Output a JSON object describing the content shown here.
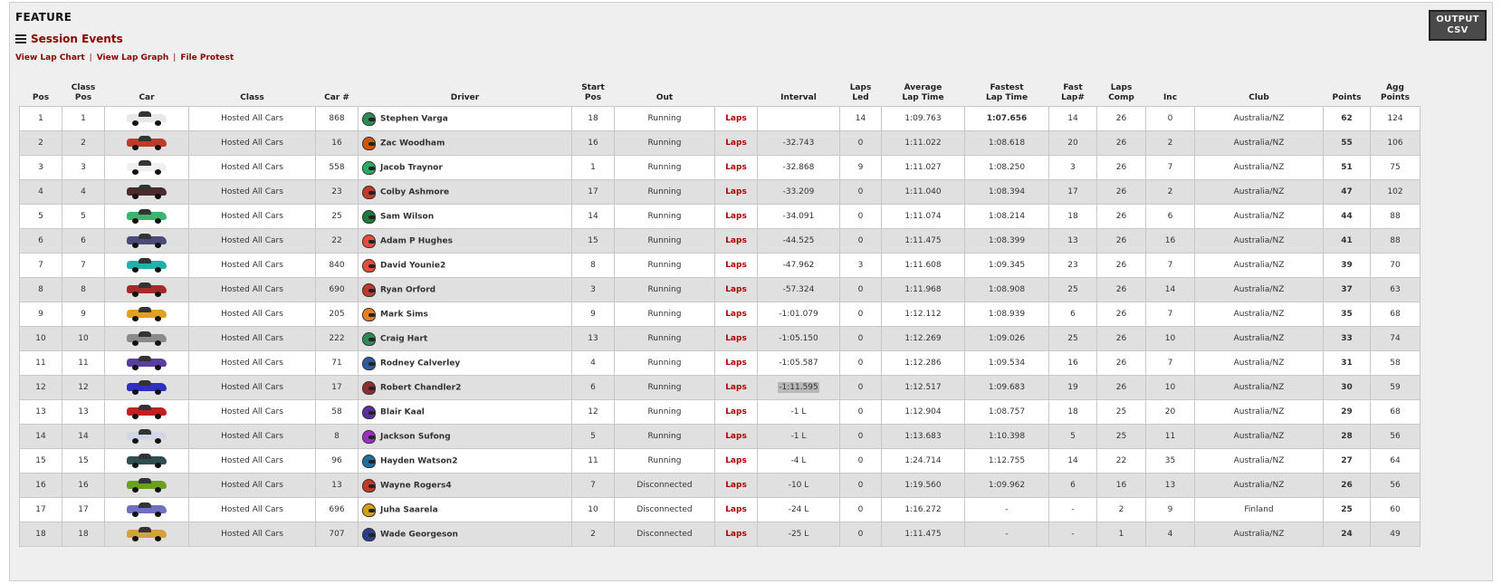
{
  "header": {
    "feature_title": "FEATURE",
    "session_events": "Session Events",
    "output_csv_line1": "OUTPUT",
    "output_csv_line2": "CSV"
  },
  "links": [
    "View Lap Chart",
    "View Lap Graph",
    "File Protest"
  ],
  "columns": [
    "Pos",
    "Class Pos",
    "Car",
    "Class",
    "Car #",
    "Driver",
    "Start\nPos",
    "Out",
    "",
    "Interval",
    "Laps\nLed",
    "Average\nLap Time",
    "Fastest\nLap Time",
    "Fast\nLap#",
    "Laps\nComp",
    "Inc",
    "Club",
    "Points",
    "Agg\nPoints"
  ],
  "laps_label": "Laps",
  "rows": [
    {
      "pos": "1",
      "class_pos": "1",
      "car_color": "#e8e8e8",
      "class": "Hosted All Cars",
      "car_num": "868",
      "helmet": "#2e8b57",
      "driver": "Stephen Varga",
      "start_pos": "18",
      "out": "Running",
      "interval": "",
      "laps_led": "14",
      "avg": "1:09.763",
      "fastest": "1:07.656",
      "fast_lap": "14",
      "laps_comp": "26",
      "inc": "0",
      "club": "Australia/NZ",
      "points": "62",
      "agg": "124"
    },
    {
      "pos": "2",
      "class_pos": "2",
      "car_color": "#c0392b",
      "class": "Hosted All Cars",
      "car_num": "16",
      "helmet": "#d35400",
      "driver": "Zac Woodham",
      "start_pos": "16",
      "out": "Running",
      "interval": "-32.743",
      "laps_led": "0",
      "avg": "1:11.022",
      "fastest": "1:08.618",
      "fast_lap": "20",
      "laps_comp": "26",
      "inc": "2",
      "club": "Australia/NZ",
      "points": "55",
      "agg": "106"
    },
    {
      "pos": "3",
      "class_pos": "3",
      "car_color": "#f0f0f0",
      "class": "Hosted All Cars",
      "car_num": "558",
      "helmet": "#27ae60",
      "driver": "Jacob Traynor",
      "start_pos": "1",
      "out": "Running",
      "interval": "-32.868",
      "laps_led": "9",
      "avg": "1:11.027",
      "fastest": "1:08.250",
      "fast_lap": "3",
      "laps_comp": "26",
      "inc": "7",
      "club": "Australia/NZ",
      "points": "51",
      "agg": "75"
    },
    {
      "pos": "4",
      "class_pos": "4",
      "car_color": "#4a2a2a",
      "class": "Hosted All Cars",
      "car_num": "23",
      "helmet": "#c0392b",
      "driver": "Colby Ashmore",
      "start_pos": "17",
      "out": "Running",
      "interval": "-33.209",
      "laps_led": "0",
      "avg": "1:11.040",
      "fastest": "1:08.394",
      "fast_lap": "17",
      "laps_comp": "26",
      "inc": "2",
      "club": "Australia/NZ",
      "points": "47",
      "agg": "102"
    },
    {
      "pos": "5",
      "class_pos": "5",
      "car_color": "#3cb371",
      "class": "Hosted All Cars",
      "car_num": "25",
      "helmet": "#1e7a3a",
      "driver": "Sam Wilson",
      "start_pos": "14",
      "out": "Running",
      "interval": "-34.091",
      "laps_led": "0",
      "avg": "1:11.074",
      "fastest": "1:08.214",
      "fast_lap": "18",
      "laps_comp": "26",
      "inc": "6",
      "club": "Australia/NZ",
      "points": "44",
      "agg": "88"
    },
    {
      "pos": "6",
      "class_pos": "6",
      "car_color": "#4b4b7a",
      "class": "Hosted All Cars",
      "car_num": "22",
      "helmet": "#e74c3c",
      "driver": "Adam P Hughes",
      "start_pos": "15",
      "out": "Running",
      "interval": "-44.525",
      "laps_led": "0",
      "avg": "1:11.475",
      "fastest": "1:08.399",
      "fast_lap": "13",
      "laps_comp": "26",
      "inc": "16",
      "club": "Australia/NZ",
      "points": "41",
      "agg": "88"
    },
    {
      "pos": "7",
      "class_pos": "7",
      "car_color": "#20b2aa",
      "class": "Hosted All Cars",
      "car_num": "840",
      "helmet": "#e74c3c",
      "driver": "David Younie2",
      "start_pos": "8",
      "out": "Running",
      "interval": "-47.962",
      "laps_led": "3",
      "avg": "1:11.608",
      "fastest": "1:09.345",
      "fast_lap": "23",
      "laps_comp": "26",
      "inc": "7",
      "club": "Australia/NZ",
      "points": "39",
      "agg": "70"
    },
    {
      "pos": "8",
      "class_pos": "8",
      "car_color": "#a52a2a",
      "class": "Hosted All Cars",
      "car_num": "690",
      "helmet": "#c0392b",
      "driver": "Ryan Orford",
      "start_pos": "3",
      "out": "Running",
      "interval": "-57.324",
      "laps_led": "0",
      "avg": "1:11.968",
      "fastest": "1:08.908",
      "fast_lap": "25",
      "laps_comp": "26",
      "inc": "14",
      "club": "Australia/NZ",
      "points": "37",
      "agg": "63"
    },
    {
      "pos": "9",
      "class_pos": "9",
      "car_color": "#e0a020",
      "class": "Hosted All Cars",
      "car_num": "205",
      "helmet": "#e67e22",
      "driver": "Mark Sims",
      "start_pos": "9",
      "out": "Running",
      "interval": "-1:01.079",
      "laps_led": "0",
      "avg": "1:12.112",
      "fastest": "1:08.939",
      "fast_lap": "6",
      "laps_comp": "26",
      "inc": "7",
      "club": "Australia/NZ",
      "points": "35",
      "agg": "68"
    },
    {
      "pos": "10",
      "class_pos": "10",
      "car_color": "#8a8a8a",
      "class": "Hosted All Cars",
      "car_num": "222",
      "helmet": "#2e8b57",
      "driver": "Craig Hart",
      "start_pos": "13",
      "out": "Running",
      "interval": "-1:05.150",
      "laps_led": "0",
      "avg": "1:12.269",
      "fastest": "1:09.026",
      "fast_lap": "25",
      "laps_comp": "26",
      "inc": "10",
      "club": "Australia/NZ",
      "points": "33",
      "agg": "74"
    },
    {
      "pos": "11",
      "class_pos": "11",
      "car_color": "#5b3fa0",
      "class": "Hosted All Cars",
      "car_num": "71",
      "helmet": "#2c5aa0",
      "driver": "Rodney Calverley",
      "start_pos": "4",
      "out": "Running",
      "interval": "-1:05.587",
      "laps_led": "0",
      "avg": "1:12.286",
      "fastest": "1:09.534",
      "fast_lap": "16",
      "laps_comp": "26",
      "inc": "7",
      "club": "Australia/NZ",
      "points": "31",
      "agg": "58"
    },
    {
      "pos": "12",
      "class_pos": "12",
      "car_color": "#3030c0",
      "class": "Hosted All Cars",
      "car_num": "17",
      "helmet": "#8b2f2f",
      "driver": "Robert Chandler2",
      "start_pos": "6",
      "out": "Running",
      "interval": "-1:11.595",
      "laps_led": "0",
      "avg": "1:12.517",
      "fastest": "1:09.683",
      "fast_lap": "19",
      "laps_comp": "26",
      "inc": "10",
      "club": "Australia/NZ",
      "points": "30",
      "agg": "59"
    },
    {
      "pos": "13",
      "class_pos": "13",
      "car_color": "#c02020",
      "class": "Hosted All Cars",
      "car_num": "58",
      "helmet": "#5b2fa0",
      "driver": "Blair Kaal",
      "start_pos": "12",
      "out": "Running",
      "interval": "-1 L",
      "laps_led": "0",
      "avg": "1:12.904",
      "fastest": "1:08.757",
      "fast_lap": "18",
      "laps_comp": "25",
      "inc": "20",
      "club": "Australia/NZ",
      "points": "29",
      "agg": "68"
    },
    {
      "pos": "14",
      "class_pos": "14",
      "car_color": "#d0d8e8",
      "class": "Hosted All Cars",
      "car_num": "8",
      "helmet": "#9b30c0",
      "driver": "Jackson Sufong",
      "start_pos": "5",
      "out": "Running",
      "interval": "-1 L",
      "laps_led": "0",
      "avg": "1:13.683",
      "fastest": "1:10.398",
      "fast_lap": "5",
      "laps_comp": "25",
      "inc": "11",
      "club": "Australia/NZ",
      "points": "28",
      "agg": "56"
    },
    {
      "pos": "15",
      "class_pos": "15",
      "car_color": "#2f4f4f",
      "class": "Hosted All Cars",
      "car_num": "96",
      "helmet": "#1e6fa0",
      "driver": "Hayden Watson2",
      "start_pos": "11",
      "out": "Running",
      "interval": "-4 L",
      "laps_led": "0",
      "avg": "1:24.714",
      "fastest": "1:12.755",
      "fast_lap": "14",
      "laps_comp": "22",
      "inc": "35",
      "club": "Australia/NZ",
      "points": "27",
      "agg": "64"
    },
    {
      "pos": "16",
      "class_pos": "16",
      "car_color": "#6aa020",
      "class": "Hosted All Cars",
      "car_num": "13",
      "helmet": "#c0392b",
      "driver": "Wayne Rogers4",
      "start_pos": "7",
      "out": "Disconnected",
      "interval": "-10 L",
      "laps_led": "0",
      "avg": "1:19.560",
      "fastest": "1:09.962",
      "fast_lap": "6",
      "laps_comp": "16",
      "inc": "13",
      "club": "Australia/NZ",
      "points": "26",
      "agg": "56"
    },
    {
      "pos": "17",
      "class_pos": "17",
      "car_color": "#7070c0",
      "class": "Hosted All Cars",
      "car_num": "696",
      "helmet": "#d4a017",
      "driver": "Juha Saarela",
      "start_pos": "10",
      "out": "Disconnected",
      "interval": "-24 L",
      "laps_led": "0",
      "avg": "1:16.272",
      "fastest": "-",
      "fast_lap": "-",
      "laps_comp": "2",
      "inc": "9",
      "club": "Finland",
      "points": "25",
      "agg": "60"
    },
    {
      "pos": "18",
      "class_pos": "18",
      "car_color": "#d4a040",
      "class": "Hosted All Cars",
      "car_num": "707",
      "helmet": "#2c3e8a",
      "driver": "Wade Georgeson",
      "start_pos": "2",
      "out": "Disconnected",
      "interval": "-25 L",
      "laps_led": "0",
      "avg": "1:11.475",
      "fastest": "-",
      "fast_lap": "-",
      "laps_comp": "1",
      "inc": "4",
      "club": "Australia/NZ",
      "points": "24",
      "agg": "49"
    }
  ]
}
